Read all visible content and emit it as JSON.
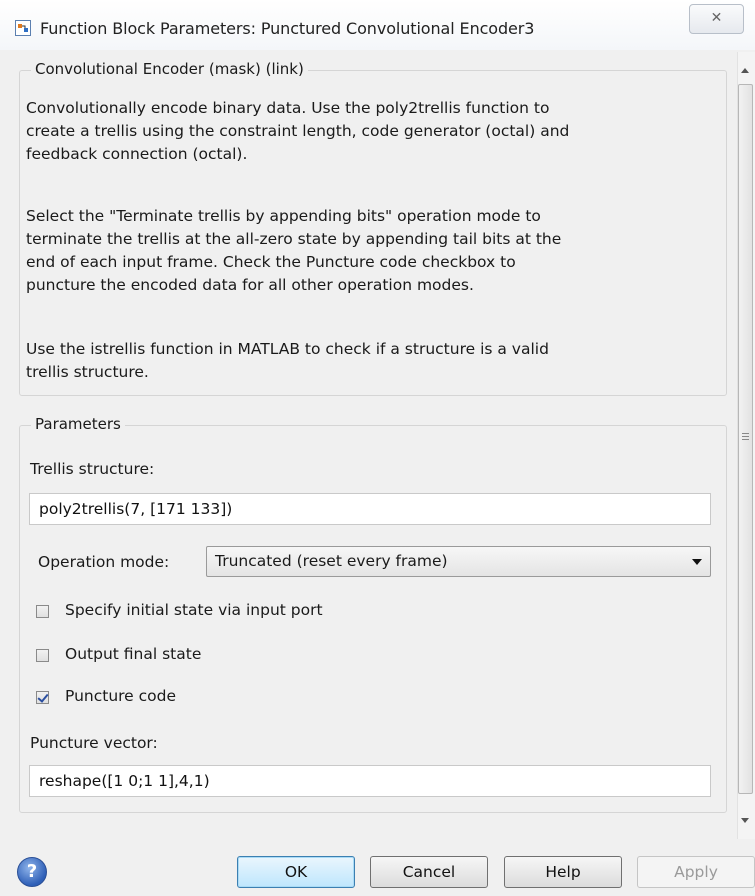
{
  "window": {
    "title": "Function Block Parameters: Punctured Convolutional Encoder3",
    "close_label": "☒"
  },
  "mask_group": {
    "label": "Convolutional Encoder (mask) (link)",
    "paragraphs": [
      [
        "Convolutionally encode binary data.  Use the poly2trellis function to",
        "create a trellis using the constraint length, code generator (octal) and",
        "feedback connection (octal)."
      ],
      [
        "Select the \"Terminate trellis by appending bits\" operation mode to",
        "terminate the trellis at the all-zero state by appending tail bits at the",
        "end of each input frame.  Check the Puncture code checkbox to",
        "puncture the encoded data for all other operation modes."
      ],
      [
        "Use the istrellis function in MATLAB to check if a structure is a valid",
        "trellis structure."
      ]
    ]
  },
  "parameters": {
    "label": "Parameters",
    "trellis_label": "Trellis structure:",
    "trellis_value": "poly2trellis(7, [171 133])",
    "operation_mode_label": "Operation mode:",
    "operation_mode_value": "Truncated (reset every frame)",
    "checkboxes": [
      {
        "label": "Specify initial state via input port",
        "checked": false
      },
      {
        "label": "Output final state",
        "checked": false
      },
      {
        "label": "Puncture code",
        "checked": true
      }
    ],
    "puncture_label": "Puncture vector:",
    "puncture_value": "reshape([1 0;1 1],4,1)"
  },
  "buttons": {
    "help_icon": "?",
    "ok": "OK",
    "cancel": "Cancel",
    "help": "Help",
    "apply": "Apply"
  }
}
